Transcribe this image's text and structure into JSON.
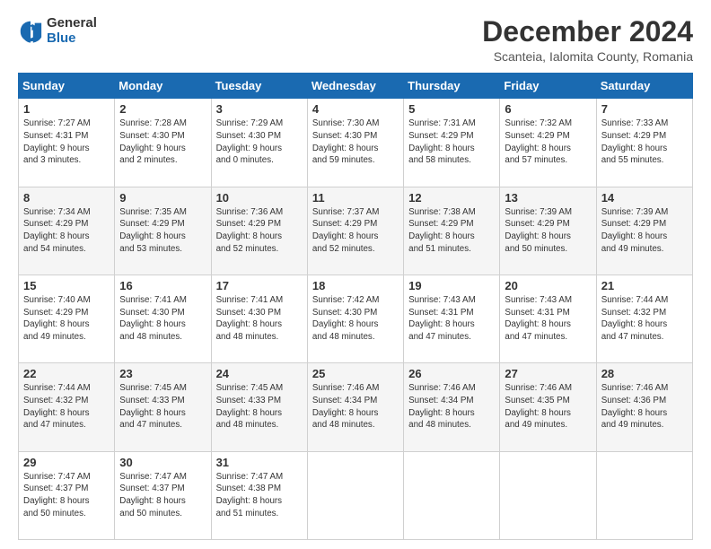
{
  "logo": {
    "general": "General",
    "blue": "Blue"
  },
  "title": "December 2024",
  "subtitle": "Scanteia, Ialomita County, Romania",
  "weekdays": [
    "Sunday",
    "Monday",
    "Tuesday",
    "Wednesday",
    "Thursday",
    "Friday",
    "Saturday"
  ],
  "weeks": [
    [
      {
        "day": 1,
        "sunrise": "7:27 AM",
        "sunset": "4:31 PM",
        "daylight": "9 hours and 3 minutes."
      },
      {
        "day": 2,
        "sunrise": "7:28 AM",
        "sunset": "4:30 PM",
        "daylight": "9 hours and 2 minutes."
      },
      {
        "day": 3,
        "sunrise": "7:29 AM",
        "sunset": "4:30 PM",
        "daylight": "9 hours and 0 minutes."
      },
      {
        "day": 4,
        "sunrise": "7:30 AM",
        "sunset": "4:30 PM",
        "daylight": "8 hours and 59 minutes."
      },
      {
        "day": 5,
        "sunrise": "7:31 AM",
        "sunset": "4:29 PM",
        "daylight": "8 hours and 58 minutes."
      },
      {
        "day": 6,
        "sunrise": "7:32 AM",
        "sunset": "4:29 PM",
        "daylight": "8 hours and 57 minutes."
      },
      {
        "day": 7,
        "sunrise": "7:33 AM",
        "sunset": "4:29 PM",
        "daylight": "8 hours and 55 minutes."
      }
    ],
    [
      {
        "day": 8,
        "sunrise": "7:34 AM",
        "sunset": "4:29 PM",
        "daylight": "8 hours and 54 minutes."
      },
      {
        "day": 9,
        "sunrise": "7:35 AM",
        "sunset": "4:29 PM",
        "daylight": "8 hours and 53 minutes."
      },
      {
        "day": 10,
        "sunrise": "7:36 AM",
        "sunset": "4:29 PM",
        "daylight": "8 hours and 52 minutes."
      },
      {
        "day": 11,
        "sunrise": "7:37 AM",
        "sunset": "4:29 PM",
        "daylight": "8 hours and 52 minutes."
      },
      {
        "day": 12,
        "sunrise": "7:38 AM",
        "sunset": "4:29 PM",
        "daylight": "8 hours and 51 minutes."
      },
      {
        "day": 13,
        "sunrise": "7:39 AM",
        "sunset": "4:29 PM",
        "daylight": "8 hours and 50 minutes."
      },
      {
        "day": 14,
        "sunrise": "7:39 AM",
        "sunset": "4:29 PM",
        "daylight": "8 hours and 49 minutes."
      }
    ],
    [
      {
        "day": 15,
        "sunrise": "7:40 AM",
        "sunset": "4:29 PM",
        "daylight": "8 hours and 49 minutes."
      },
      {
        "day": 16,
        "sunrise": "7:41 AM",
        "sunset": "4:30 PM",
        "daylight": "8 hours and 48 minutes."
      },
      {
        "day": 17,
        "sunrise": "7:41 AM",
        "sunset": "4:30 PM",
        "daylight": "8 hours and 48 minutes."
      },
      {
        "day": 18,
        "sunrise": "7:42 AM",
        "sunset": "4:30 PM",
        "daylight": "8 hours and 48 minutes."
      },
      {
        "day": 19,
        "sunrise": "7:43 AM",
        "sunset": "4:31 PM",
        "daylight": "8 hours and 47 minutes."
      },
      {
        "day": 20,
        "sunrise": "7:43 AM",
        "sunset": "4:31 PM",
        "daylight": "8 hours and 47 minutes."
      },
      {
        "day": 21,
        "sunrise": "7:44 AM",
        "sunset": "4:32 PM",
        "daylight": "8 hours and 47 minutes."
      }
    ],
    [
      {
        "day": 22,
        "sunrise": "7:44 AM",
        "sunset": "4:32 PM",
        "daylight": "8 hours and 47 minutes."
      },
      {
        "day": 23,
        "sunrise": "7:45 AM",
        "sunset": "4:33 PM",
        "daylight": "8 hours and 47 minutes."
      },
      {
        "day": 24,
        "sunrise": "7:45 AM",
        "sunset": "4:33 PM",
        "daylight": "8 hours and 48 minutes."
      },
      {
        "day": 25,
        "sunrise": "7:46 AM",
        "sunset": "4:34 PM",
        "daylight": "8 hours and 48 minutes."
      },
      {
        "day": 26,
        "sunrise": "7:46 AM",
        "sunset": "4:34 PM",
        "daylight": "8 hours and 48 minutes."
      },
      {
        "day": 27,
        "sunrise": "7:46 AM",
        "sunset": "4:35 PM",
        "daylight": "8 hours and 49 minutes."
      },
      {
        "day": 28,
        "sunrise": "7:46 AM",
        "sunset": "4:36 PM",
        "daylight": "8 hours and 49 minutes."
      }
    ],
    [
      {
        "day": 29,
        "sunrise": "7:47 AM",
        "sunset": "4:37 PM",
        "daylight": "8 hours and 50 minutes."
      },
      {
        "day": 30,
        "sunrise": "7:47 AM",
        "sunset": "4:37 PM",
        "daylight": "8 hours and 50 minutes."
      },
      {
        "day": 31,
        "sunrise": "7:47 AM",
        "sunset": "4:38 PM",
        "daylight": "8 hours and 51 minutes."
      },
      null,
      null,
      null,
      null
    ]
  ]
}
